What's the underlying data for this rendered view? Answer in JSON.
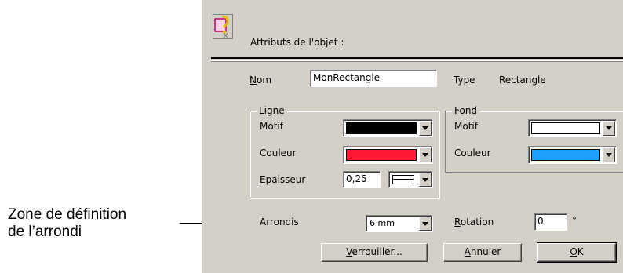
{
  "callout": {
    "line1": "Zone de définition",
    "line2": "de l’arrondi"
  },
  "dialog": {
    "header_title": "Attributs de l'objet :",
    "icon": "object-attributes-icon",
    "name": {
      "label_accel": "N",
      "label_rest": "om",
      "value": "MonRectangle"
    },
    "type": {
      "label": "Type",
      "value": "Rectangle"
    },
    "ligne": {
      "title": "Ligne",
      "motif_label": "Motif",
      "motif_color": "#000000",
      "couleur_label": "Couleur",
      "couleur_color": "#ff1a33",
      "epaisseur_accel": "E",
      "epaisseur_rest": "paisseur",
      "epaisseur_value": "0,25"
    },
    "fond": {
      "title": "Fond",
      "motif_label": "Motif",
      "motif_color": "#ffffff",
      "couleur_label": "Couleur",
      "couleur_color": "#1ea0ff"
    },
    "arrondis": {
      "label": "Arrondis",
      "value": "6 mm"
    },
    "rotation": {
      "label_accel": "R",
      "label_rest": "otation",
      "value": "0",
      "unit": "°"
    },
    "buttons": {
      "lock": {
        "accel": "V",
        "rest": "errouiller..."
      },
      "cancel": {
        "accel": "A",
        "rest": "nnuler"
      },
      "ok": {
        "accel": "O",
        "rest": "K"
      }
    }
  }
}
